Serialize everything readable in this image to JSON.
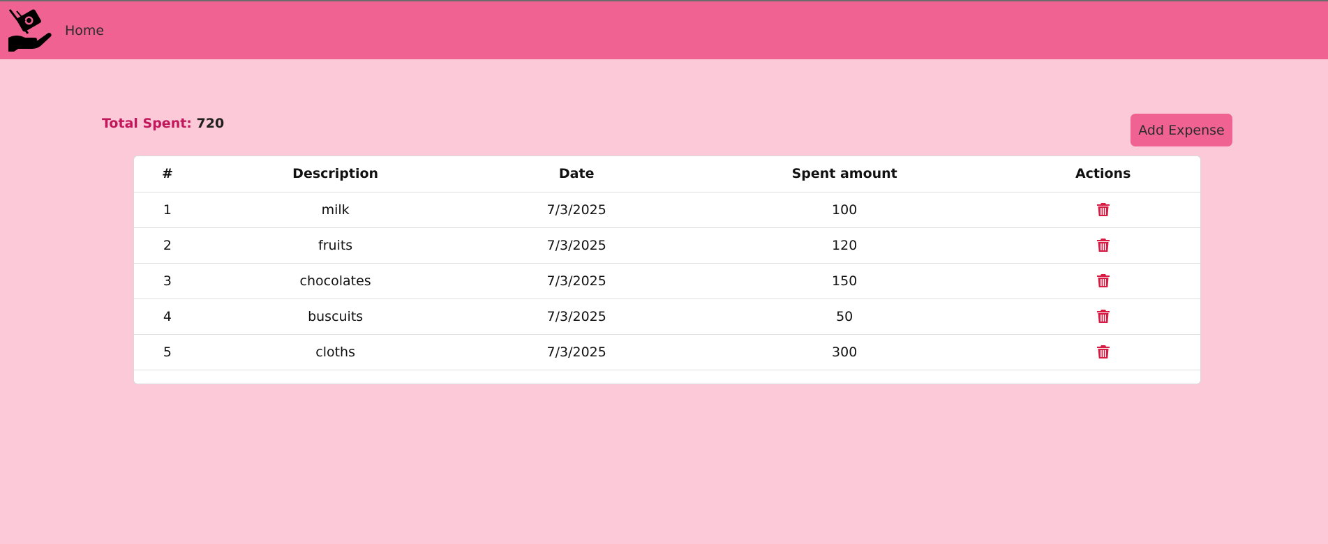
{
  "navbar": {
    "logo_icon": "hand-money-icon",
    "home_label": "Home",
    "background": "#f06292"
  },
  "summary": {
    "total_label": "Total Spent:",
    "total_value": "720"
  },
  "actions": {
    "add_expense_label": "Add Expense"
  },
  "table": {
    "headers": [
      "#",
      "Description",
      "Date",
      "Spent amount",
      "Actions"
    ],
    "rows": [
      {
        "index": "1",
        "description": "milk",
        "date": "7/3/2025",
        "amount": "100",
        "action_icon": "trash-icon"
      },
      {
        "index": "2",
        "description": "fruits",
        "date": "7/3/2025",
        "amount": "120",
        "action_icon": "trash-icon"
      },
      {
        "index": "3",
        "description": "chocolates",
        "date": "7/3/2025",
        "amount": "150",
        "action_icon": "trash-icon"
      },
      {
        "index": "4",
        "description": "buscuits",
        "date": "7/3/2025",
        "amount": "50",
        "action_icon": "trash-icon"
      },
      {
        "index": "5",
        "description": "cloths",
        "date": "7/3/2025",
        "amount": "300",
        "action_icon": "trash-icon"
      }
    ]
  },
  "colors": {
    "page_background": "#fbc9d8",
    "accent": "#f06292",
    "total_label": "#c2185b",
    "delete_icon": "#d81b42"
  }
}
